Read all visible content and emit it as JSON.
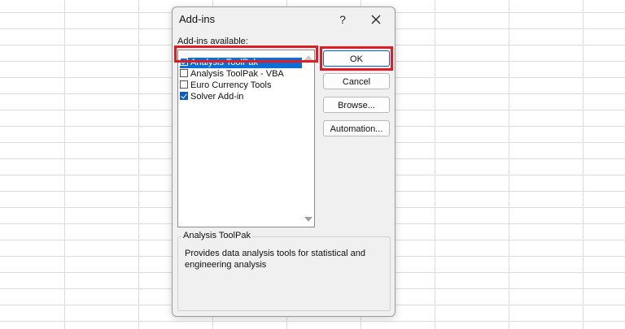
{
  "dialog": {
    "title": "Add-ins",
    "help_label": "?",
    "available_label": "Add-ins available:",
    "items": [
      {
        "label": "Analysis ToolPak",
        "checked": true,
        "selected": true
      },
      {
        "label": "Analysis ToolPak - VBA",
        "checked": false,
        "selected": false
      },
      {
        "label": "Euro Currency Tools",
        "checked": false,
        "selected": false
      },
      {
        "label": "Solver Add-in",
        "checked": true,
        "selected": false
      }
    ],
    "buttons": {
      "ok": "OK",
      "cancel": "Cancel",
      "browse": "Browse...",
      "automation": "Automation..."
    },
    "description": {
      "title": "Analysis ToolPak",
      "text": "Provides data analysis tools for statistical and engineering analysis"
    }
  },
  "colors": {
    "highlight": "#e01d25",
    "selection": "#0b6fd6",
    "checkbox": "#0b5cc8"
  }
}
